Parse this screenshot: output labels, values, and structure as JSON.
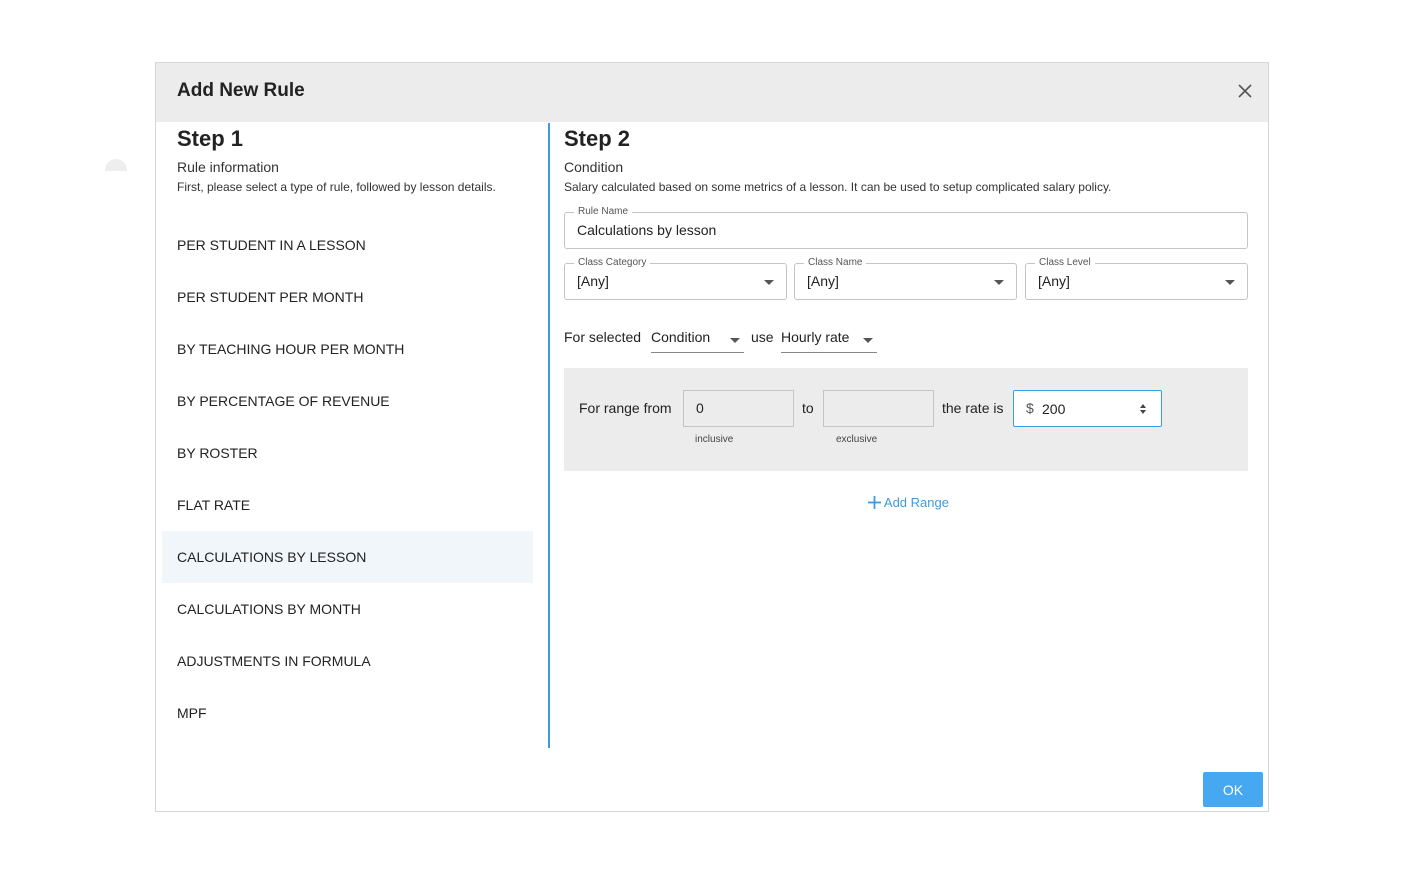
{
  "dialog": {
    "title": "Add New Rule",
    "ok_label": "OK",
    "close_icon": "close-icon"
  },
  "step1": {
    "title": "Step 1",
    "subtitle": "Rule information",
    "description": "First, please select a type of rule, followed by lesson details.",
    "rules": [
      {
        "label": "PER STUDENT IN A LESSON"
      },
      {
        "label": "PER STUDENT PER MONTH"
      },
      {
        "label": "BY TEACHING HOUR PER MONTH"
      },
      {
        "label": "BY PERCENTAGE OF REVENUE"
      },
      {
        "label": "BY ROSTER"
      },
      {
        "label": "FLAT RATE"
      },
      {
        "label": "CALCULATIONS BY LESSON"
      },
      {
        "label": "CALCULATIONS BY MONTH"
      },
      {
        "label": "ADJUSTMENTS IN FORMULA"
      },
      {
        "label": "MPF"
      }
    ],
    "selected_rule": "CALCULATIONS BY LESSON"
  },
  "step2": {
    "title": "Step 2",
    "subtitle": "Condition",
    "description": "Salary calculated based on some metrics of a lesson. It can be used to setup complicated salary policy.",
    "rule_name": {
      "label": "Rule Name",
      "value": "Calculations by lesson"
    },
    "class_category": {
      "label": "Class Category",
      "value": "[Any]"
    },
    "class_name": {
      "label": "Class Name",
      "value": "[Any]"
    },
    "class_level": {
      "label": "Class Level",
      "value": "[Any]"
    },
    "condition_row": {
      "prefix": "For selected",
      "condition_value": "Condition",
      "use_text": "use",
      "rate_type_value": "Hourly rate"
    },
    "range": {
      "from_text": "For range from",
      "from_value": "0",
      "from_hint": "inclusive",
      "to_text": "to",
      "to_value": "",
      "to_hint": "exclusive",
      "rate_text": "the rate is",
      "currency": "$",
      "rate_value": "200"
    },
    "add_range_label": "Add Range"
  },
  "colors": {
    "accent": "#3d9be0",
    "ok_button": "#45a8f0",
    "header_bg": "#ececec",
    "selected_bg": "#f1f6fb"
  }
}
